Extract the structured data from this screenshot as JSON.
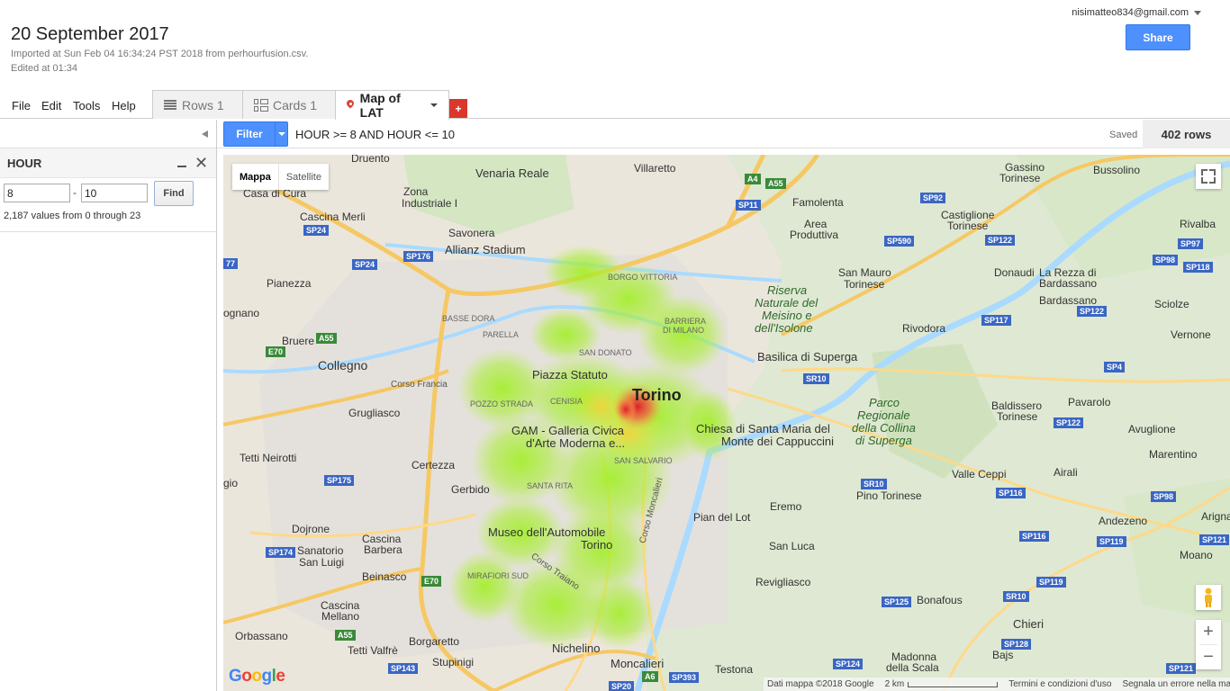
{
  "header": {
    "title": "20 September 2017",
    "imported": "Imported at Sun Feb 04 16:34:24 PST 2018 from perhourfusion.csv.",
    "edited": "Edited at 01:34",
    "account": "nisimatteo834@gmail.com",
    "share_label": "Share"
  },
  "menu": {
    "file": "File",
    "edit": "Edit",
    "tools": "Tools",
    "help": "Help"
  },
  "tabs": [
    {
      "label": "Rows 1"
    },
    {
      "label": "Cards 1"
    },
    {
      "label": "Map of LAT"
    }
  ],
  "add_tab_label": "+",
  "filter_panel": {
    "column": "HOUR",
    "min": "8",
    "max": "10",
    "dash": "-",
    "find_label": "Find",
    "note": "2,187 values from 0 through 23"
  },
  "filterbar": {
    "filter_label": "Filter",
    "condition": "HOUR >= 8 AND HOUR <= 10",
    "saved": "Saved",
    "rows": "402 rows"
  },
  "map": {
    "type_map": "Mappa",
    "type_satellite": "Satellite",
    "logo": "Google",
    "attribution": "Dati mappa ©2018 Google",
    "scale": "2 km",
    "terms": "Termini e condizioni d'uso",
    "report": "Segnala un errore nella mappa",
    "zoom_in": "+",
    "zoom_out": "−",
    "places": {
      "torino": "Torino",
      "venaria": "Venaria Reale",
      "villaretto": "Villaretto",
      "gassino": "Gassino",
      "gassino2": "Torinese",
      "bussolino": "Bussolino",
      "druento": "Druento",
      "casa_di_cura": "Casa di Cura",
      "zona_ind": "Zona",
      "zona_ind2": "Industriale I",
      "famolenta": "Famolenta",
      "area_prod": "Area",
      "area_prod2": "Produttiva",
      "castiglione": "Castiglione",
      "castiglione2": "Torinese",
      "rivalba": "Rivalba",
      "cascina_merli": "Cascina Merli",
      "savonera": "Savonera",
      "allianz": "Allianz Stadium",
      "la_rezza": "La Rezza di",
      "la_rezza2": "Bardassano",
      "donaudi": "Donaudi",
      "bardassano": "Bardassano",
      "sciolze": "Sciolze",
      "pianezza": "Pianezza",
      "borgo_vittoria": "BORGO VITTORIA",
      "san_mauro": "San Mauro",
      "san_mauro2": "Torinese",
      "riserva": "Riserva",
      "riserva2": "Naturale del",
      "riserva3": "Meisino e",
      "riserva4": "dell'Isolone",
      "basse_dora": "BASSE DORA",
      "barriera": "BARRIERA",
      "barriera2": "DI MILANO",
      "rivodora": "Rivodora",
      "vernone": "Vernone",
      "bruere": "Bruere",
      "parella": "PARELLA",
      "san_donato": "SAN DONATO",
      "collegno": "Collegno",
      "superga": "Basilica di Superga",
      "piazza_statuto": "Piazza Statuto",
      "corso_francia": "Corso Francia",
      "pozzo_strada": "POZZO STRADA",
      "cenisia": "CENISIA",
      "grugliasco": "Grugliasco",
      "parco": "Parco",
      "parco2": "Regionale",
      "parco3": "della Collina",
      "parco4": "di Superga",
      "baldissero": "Baldissero",
      "baldissero2": "Torinese",
      "pavarolo": "Pavarolo",
      "gam": "GAM - Galleria Civica",
      "gam2": "d'Arte Moderna e...",
      "chiesa": "Chiesa di Santa Maria del",
      "chiesa2": "Monte dei Cappuccini",
      "avuglione": "Avuglione",
      "tetti_neirotti": "Tetti Neirotti",
      "certezza": "Certezza",
      "san_salvario": "SAN SALVARIO",
      "valle_ceppi": "Valle Ceppi",
      "marentino": "Marentino",
      "airali": "Airali",
      "gerbido": "Gerbido",
      "santa_rita": "SANTA RITA",
      "pino": "Pino Torinese",
      "pian_del_lot": "Pian del Lot",
      "eremo": "Eremo",
      "andezeno": "Andezeno",
      "dojrone": "Dojrone",
      "sanatorio": "Sanatorio",
      "sanatorio2": "San Luigi",
      "cascina_barbera": "Cascina",
      "cascina_barbera2": "Barbera",
      "museo": "Museo dell'Automobile",
      "museo2": "Torino",
      "san_luca": "San Luca",
      "moano": "Moano",
      "beinasco": "Beinasco",
      "mirafiori": "MIRAFIORI SUD",
      "corso_traiano": "Corso Traiano",
      "corso_moncalieri": "Corso Moncalieri",
      "revigliasco": "Revigliasco",
      "cascina_mellano": "Cascina",
      "cascina_mellano2": "Mellano",
      "bonafous": "Bonafous",
      "chieri": "Chieri",
      "orbassano": "Orbassano",
      "borgaretto": "Borgaretto",
      "tetti_valfre": "Tetti Valfrè",
      "nichelino": "Nichelino",
      "bajs": "Bajs",
      "stupinigi": "Stupinigi",
      "moncalieri": "Moncalieri",
      "testona": "Testona",
      "madonna": "Madonna",
      "madonna2": "della Scala",
      "ognano": "ognano",
      "gio": "gio",
      "arigna": "Arigna"
    },
    "roads": {
      "a4": "A4",
      "a55a": "A55",
      "sp11": "SP11",
      "sp92": "SP92",
      "sp24a": "SP24",
      "sp24b": "SP24",
      "sp176": "SP176",
      "sp590": "SP590",
      "sp122a": "SP122",
      "sp97": "SP97",
      "sp98a": "SP98",
      "sp118": "SP118",
      "sp122b": "SP122",
      "sp117": "SP117",
      "a55b": "A55",
      "e70a": "E70",
      "sr10a": "SR10",
      "sp4": "SP4",
      "sp122c": "SP122",
      "sp175": "SP175",
      "sr10b": "SR10",
      "sp116": "SP116",
      "sp98b": "SP98",
      "sp174": "SP174",
      "sp116b": "SP116",
      "sp119a": "SP119",
      "sp121a": "SP121",
      "e70b": "E70",
      "sp119b": "SP119",
      "sp125": "SP125",
      "sr10c": "SR10",
      "a55c": "A55",
      "sp128": "SP128",
      "sp143": "SP143",
      "a6": "A6",
      "sp393": "SP393",
      "sp124": "SP124",
      "sp121b": "SP121",
      "sp20": "SP20",
      "n77": "77"
    }
  }
}
